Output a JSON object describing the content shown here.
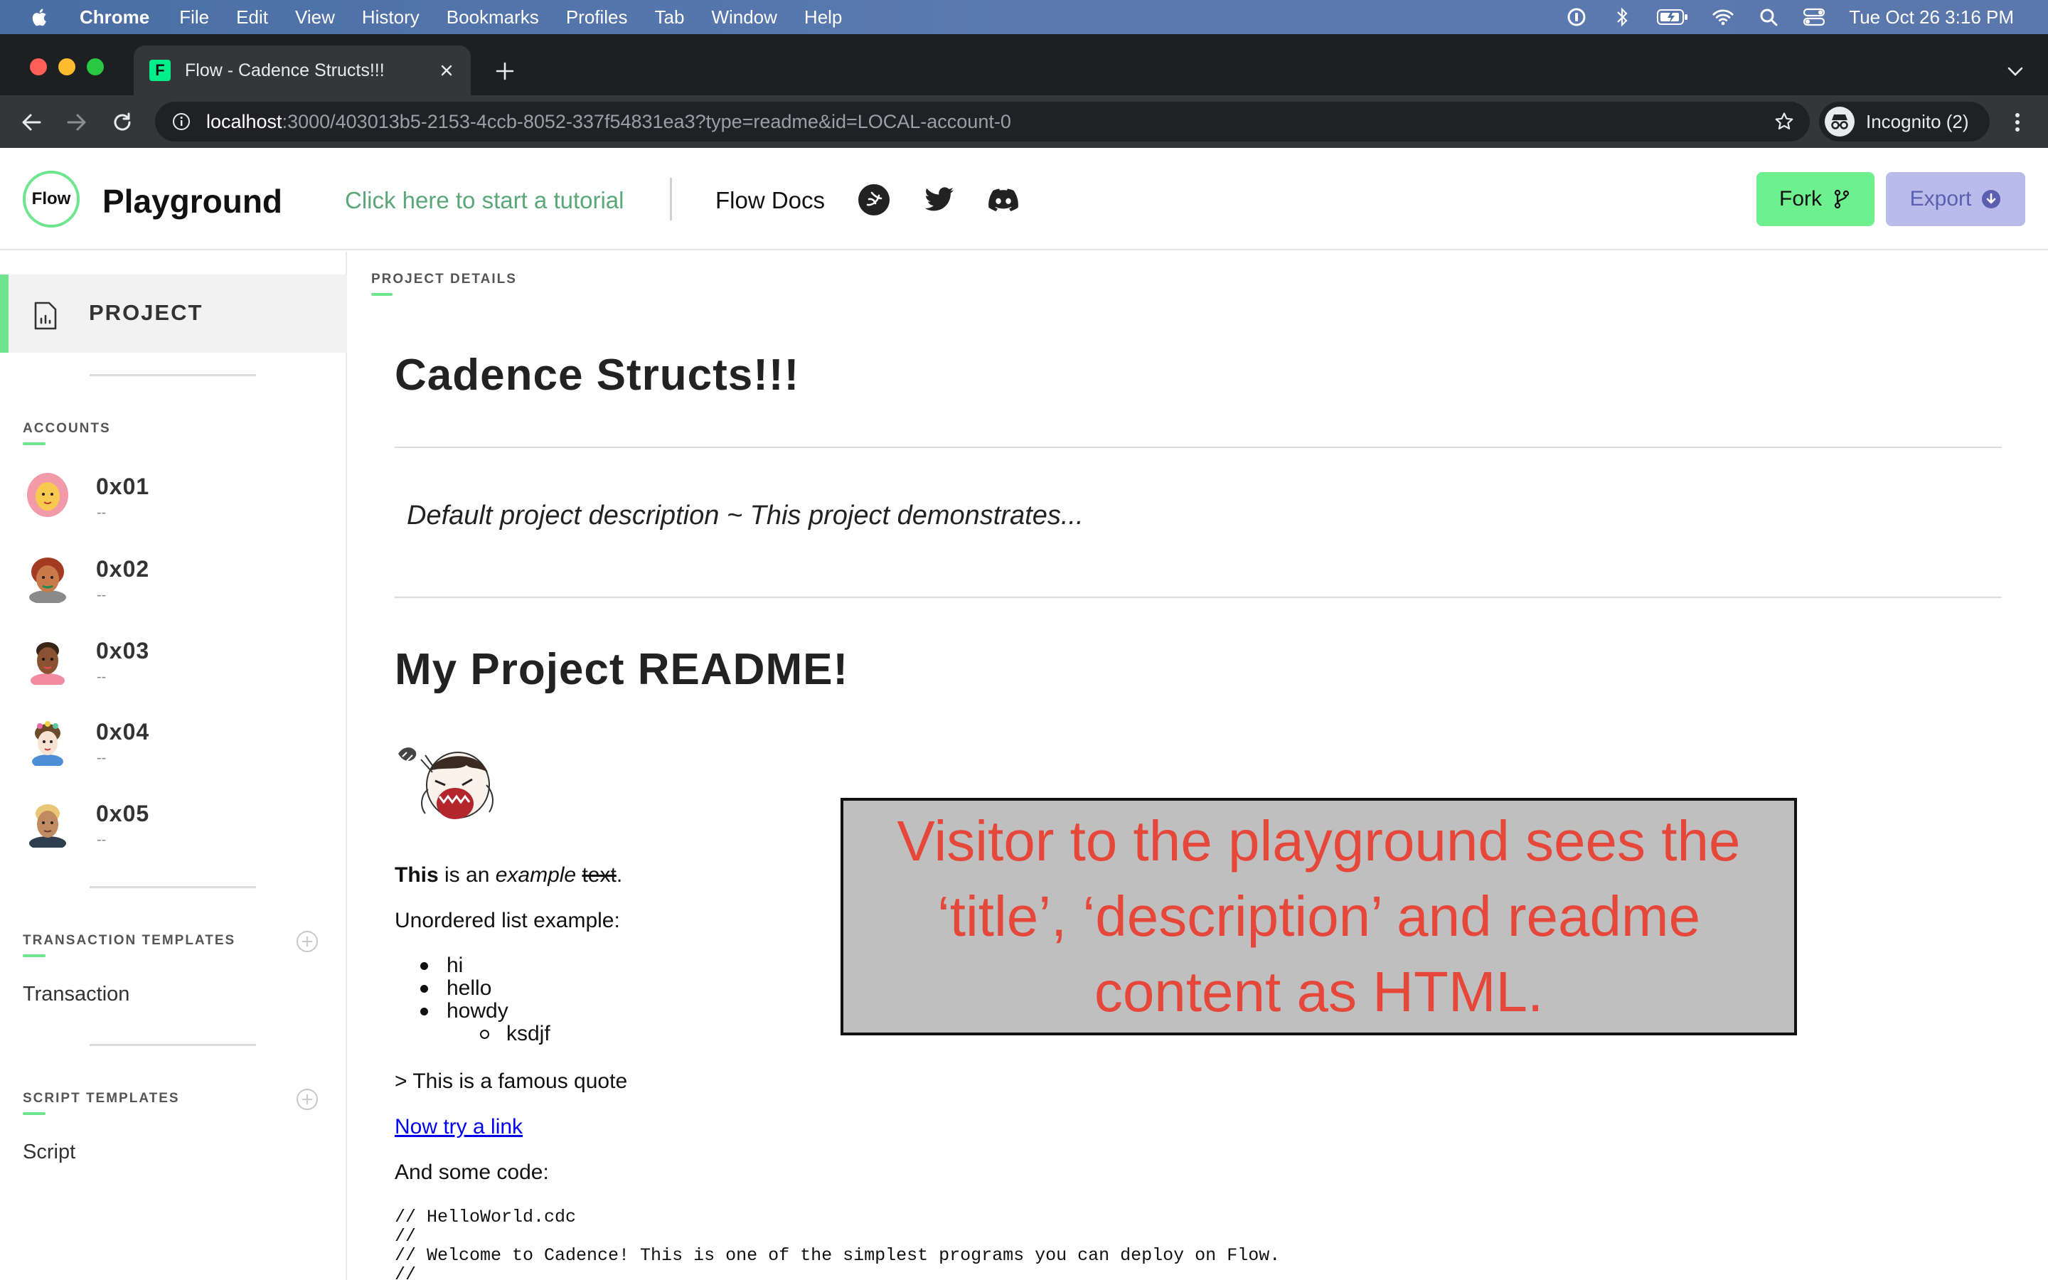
{
  "menubar": {
    "app_name": "Chrome",
    "items": [
      "File",
      "Edit",
      "View",
      "History",
      "Bookmarks",
      "Profiles",
      "Tab",
      "Window",
      "Help"
    ],
    "clock": "Tue Oct 26  3:16 PM"
  },
  "browser": {
    "tab_title": "Flow - Cadence Structs!!!",
    "favicon_letter": "F",
    "url_host": "localhost",
    "url_rest": ":3000/403013b5-2153-4ccb-8052-337f54831ea3?type=readme&id=LOCAL-account-0",
    "profile_label": "Incognito (2)"
  },
  "header": {
    "logo_text": "Flow",
    "title": "Playground",
    "tutorial_link": "Click here to start a tutorial",
    "docs_link": "Flow Docs",
    "fork_label": "Fork",
    "export_label": "Export"
  },
  "sidebar": {
    "project_label": "PROJECT",
    "accounts_heading": "ACCOUNTS",
    "accounts": [
      {
        "address": "0x01",
        "sub": "--"
      },
      {
        "address": "0x02",
        "sub": "--"
      },
      {
        "address": "0x03",
        "sub": "--"
      },
      {
        "address": "0x04",
        "sub": "--"
      },
      {
        "address": "0x05",
        "sub": "--"
      }
    ],
    "transaction_heading": "TRANSACTION TEMPLATES",
    "transaction_item": "Transaction",
    "script_heading": "SCRIPT TEMPLATES",
    "script_item": "Script"
  },
  "main": {
    "breadcrumb": "PROJECT DETAILS",
    "project_title": "Cadence Structs!!!",
    "description": "Default project description ~ This project demonstrates...",
    "readme": {
      "heading": "My Project README!",
      "sentence": {
        "bold": "This",
        "mid": " is an ",
        "italic": "example",
        "space": " ",
        "strike": "text",
        "end": "."
      },
      "list_intro": "Unordered list example:",
      "list_items": [
        "hi",
        "hello",
        "howdy"
      ],
      "nested_item": "ksdjf",
      "quote": "> This is a famous quote",
      "link_text": "Now try a link",
      "code_intro": "And some code:",
      "code": "// HelloWorld.cdc\n//\n// Welcome to Cadence! This is one of the simplest programs you can deploy on Flow.\n//"
    }
  },
  "annotation": {
    "text": "Visitor to the playground sees the ‘title’, ‘description’ and readme content as HTML."
  }
}
